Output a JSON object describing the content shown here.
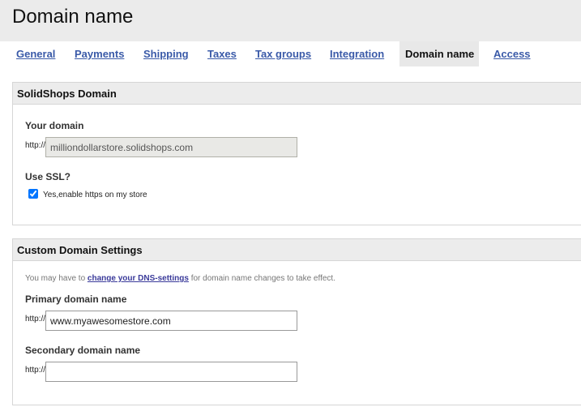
{
  "page": {
    "title": "Domain name"
  },
  "tabs": [
    {
      "label": "General",
      "active": false
    },
    {
      "label": "Payments",
      "active": false
    },
    {
      "label": "Shipping",
      "active": false
    },
    {
      "label": "Taxes",
      "active": false
    },
    {
      "label": "Tax groups",
      "active": false
    },
    {
      "label": "Integration",
      "active": false
    },
    {
      "label": "Domain name",
      "active": true
    },
    {
      "label": "Access",
      "active": false
    }
  ],
  "solidshops_domain": {
    "title": "SolidShops Domain",
    "your_domain_label": "Your domain",
    "prefix": "http://",
    "domain_value": "milliondollarstore.solidshops.com",
    "ssl_label": "Use SSL?",
    "ssl_checked": true,
    "ssl_checkbox_label": "Yes,enable https on my store"
  },
  "custom_domain": {
    "title": "Custom Domain Settings",
    "hint_before": "You may have to ",
    "hint_link": "change your DNS-settings",
    "hint_after": " for domain name changes to take effect.",
    "primary_label": "Primary domain name",
    "primary_prefix": "http://",
    "primary_value": "www.myawesomestore.com",
    "secondary_label": "Secondary domain name",
    "secondary_prefix": "http://",
    "secondary_value": ""
  }
}
